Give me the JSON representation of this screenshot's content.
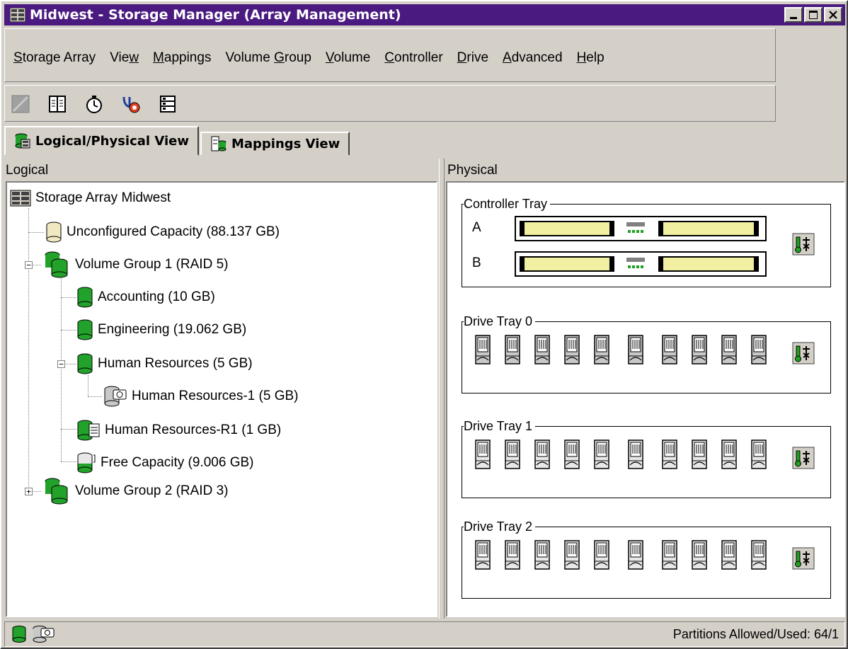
{
  "window": {
    "title": "Midwest - Storage Manager (Array Management)",
    "title_bar_color": "#4a1a80"
  },
  "menu": [
    {
      "pre": "",
      "u": "S",
      "post": "torage Array"
    },
    {
      "pre": "Vie",
      "u": "w",
      "post": ""
    },
    {
      "pre": "",
      "u": "M",
      "post": "appings"
    },
    {
      "pre": "Volume ",
      "u": "G",
      "post": "roup"
    },
    {
      "pre": "",
      "u": "V",
      "post": "olume"
    },
    {
      "pre": "",
      "u": "C",
      "post": "ontroller"
    },
    {
      "pre": "",
      "u": "D",
      "post": "rive"
    },
    {
      "pre": "",
      "u": "A",
      "post": "dvanced"
    },
    {
      "pre": "",
      "u": "H",
      "post": "elp"
    }
  ],
  "toolbar_icons": [
    "create-icon",
    "book-icon",
    "stopwatch-icon",
    "stethoscope-icon",
    "storage-array-icon"
  ],
  "tabs": [
    {
      "label": "Logical/Physical View",
      "icon": "logical-physical-icon",
      "active": true
    },
    {
      "label": "Mappings View",
      "icon": "mappings-icon",
      "active": false
    }
  ],
  "logical": {
    "header": "Logical",
    "tree": [
      {
        "label": "Storage Array Midwest",
        "icon": "storage-array-icon"
      },
      {
        "label": "Unconfigured Capacity (88.137 GB)",
        "icon": "unconfigured-icon"
      },
      {
        "label": "Volume Group 1 (RAID 5)",
        "icon": "volume-group-icon"
      },
      {
        "label": "Accounting (10 GB)",
        "icon": "volume-icon"
      },
      {
        "label": "Engineering (19.062 GB)",
        "icon": "volume-icon"
      },
      {
        "label": "Human Resources  (5 GB)",
        "icon": "volume-icon"
      },
      {
        "label": "Human Resources-1 (5 GB)",
        "icon": "snapshot-icon"
      },
      {
        "label": "Human Resources-R1 (1 GB)",
        "icon": "repository-icon"
      },
      {
        "label": "Free Capacity  (9.006 GB)",
        "icon": "free-capacity-icon"
      },
      {
        "label": "Volume Group 2  (RAID 3)",
        "icon": "volume-group-icon"
      }
    ]
  },
  "physical": {
    "header": "Physical",
    "controller_tray": {
      "label": "Controller Tray",
      "controllers": [
        "A",
        "B"
      ]
    },
    "drive_trays": [
      {
        "label": "Drive Tray 0",
        "drives": 10,
        "assigned": true
      },
      {
        "label": "Drive Tray 1",
        "drives": 10,
        "assigned": false
      },
      {
        "label": "Drive Tray 2",
        "drives": 10,
        "assigned": false
      }
    ]
  },
  "status": {
    "text": "Partitions Allowed/Used: 64/1",
    "icons": [
      "volume-icon",
      "snapshot-icon"
    ]
  },
  "colors": {
    "volume_green": "#22a22a",
    "drive_assigned": "#c8c8c8",
    "drive_unassigned": "#e8e8e8",
    "controller_yellow": "#f0f0a0"
  }
}
